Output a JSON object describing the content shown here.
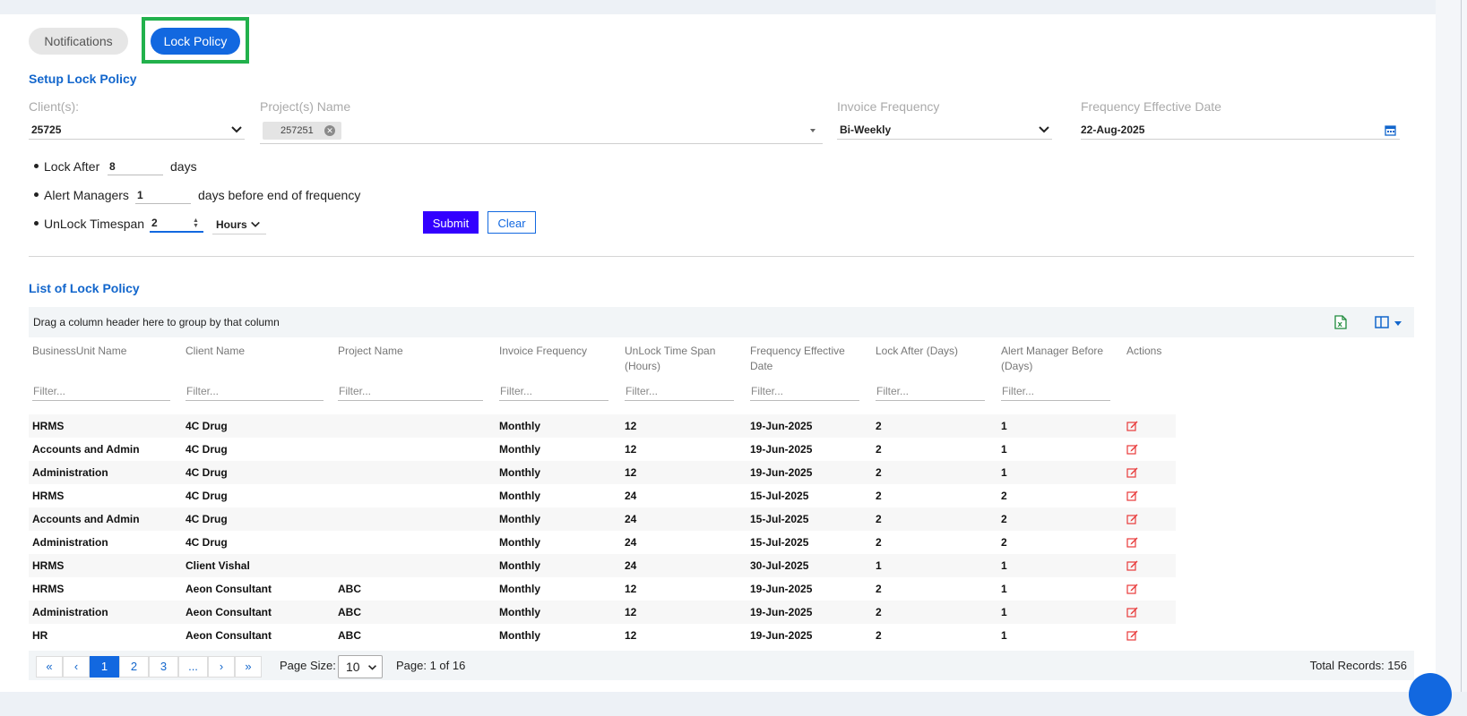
{
  "tabs": {
    "notifications": "Notifications",
    "lock_policy": "Lock Policy"
  },
  "setup": {
    "title": "Setup Lock Policy",
    "clients_label": "Client(s):",
    "clients_value": "25725",
    "projects_label": "Project(s) Name",
    "project_chip": "257251",
    "invoice_label": "Invoice Frequency",
    "invoice_value": "Bi-Weekly",
    "effective_label": "Frequency Effective Date",
    "effective_value": "22-Aug-2025",
    "lock_after_label": "Lock After",
    "lock_after_value": "8",
    "lock_after_unit": "days",
    "alert_label": "Alert Managers",
    "alert_value": "1",
    "alert_unit": "days before end of frequency",
    "unlock_label": "UnLock Timespan",
    "unlock_value": "2",
    "unlock_unit": "Hours",
    "submit": "Submit",
    "clear": "Clear"
  },
  "list": {
    "title": "List of Lock Policy",
    "group_hint": "Drag a column header here to group by that column",
    "filter_placeholder": "Filter...",
    "columns": [
      "BusinessUnit Name",
      "Client Name",
      "Project Name",
      "Invoice Frequency",
      "UnLock Time Span (Hours)",
      "Frequency Effective Date",
      "Lock After (Days)",
      "Alert Manager Before (Days)",
      "Actions"
    ],
    "rows": [
      [
        "HRMS",
        "4C Drug",
        "",
        "Monthly",
        "12",
        "19-Jun-2025",
        "2",
        "1"
      ],
      [
        "Accounts and Admin",
        "4C Drug",
        "",
        "Monthly",
        "12",
        "19-Jun-2025",
        "2",
        "1"
      ],
      [
        "Administration",
        "4C Drug",
        "",
        "Monthly",
        "12",
        "19-Jun-2025",
        "2",
        "1"
      ],
      [
        "HRMS",
        "4C Drug",
        "",
        "Monthly",
        "24",
        "15-Jul-2025",
        "2",
        "2"
      ],
      [
        "Accounts and Admin",
        "4C Drug",
        "",
        "Monthly",
        "24",
        "15-Jul-2025",
        "2",
        "2"
      ],
      [
        "Administration",
        "4C Drug",
        "",
        "Monthly",
        "24",
        "15-Jul-2025",
        "2",
        "2"
      ],
      [
        "HRMS",
        "Client Vishal",
        "",
        "Monthly",
        "24",
        "30-Jul-2025",
        "1",
        "1"
      ],
      [
        "HRMS",
        "Aeon Consultant",
        "ABC",
        "Monthly",
        "12",
        "19-Jun-2025",
        "2",
        "1"
      ],
      [
        "Administration",
        "Aeon Consultant",
        "ABC",
        "Monthly",
        "12",
        "19-Jun-2025",
        "2",
        "1"
      ],
      [
        "HR",
        "Aeon Consultant",
        "ABC",
        "Monthly",
        "12",
        "19-Jun-2025",
        "2",
        "1"
      ]
    ]
  },
  "pager": {
    "first": "«",
    "prev": "‹",
    "pages": [
      "1",
      "2",
      "3",
      "..."
    ],
    "next": "›",
    "last": "»",
    "page_size_label": "Page Size:",
    "page_size_value": "10",
    "page_info": "Page: 1 of 16",
    "total": "Total Records: 156"
  },
  "colors": {
    "accent": "#1268e0",
    "submit": "#3300ff",
    "highlight": "#22b14c",
    "edit": "#e83a3a"
  }
}
